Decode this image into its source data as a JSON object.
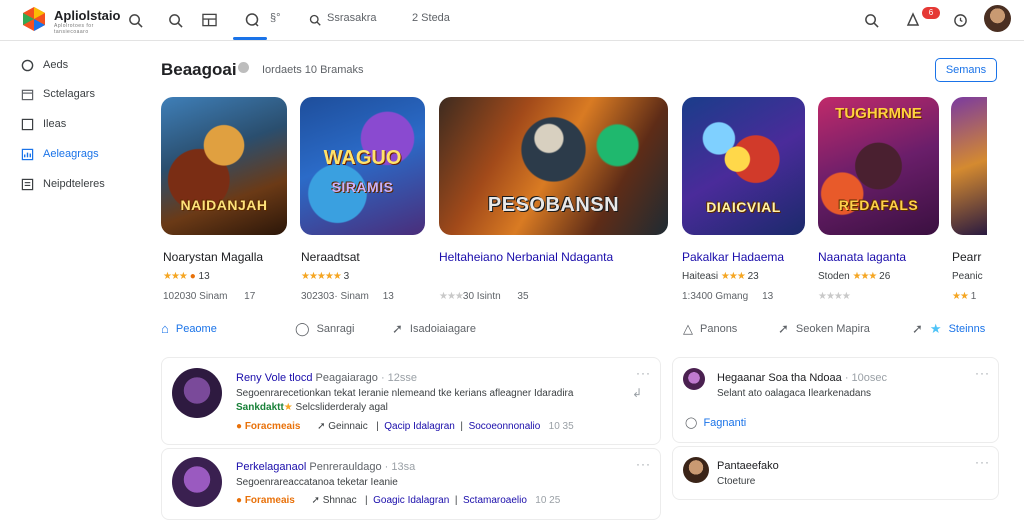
{
  "app": {
    "name": "Apliolstaio",
    "tagline": "Aplolrotoes for tansiecoaaro"
  },
  "topbar": {
    "tabs": [
      "§°",
      "Ssrasakra",
      "2 Steda"
    ],
    "notification_count": "6"
  },
  "sidebar": {
    "items": [
      {
        "label": "Aeds",
        "icon": "circle-icon"
      },
      {
        "label": "Sctelagars",
        "icon": "calendar-icon"
      },
      {
        "label": "Ileas",
        "icon": "square-icon"
      },
      {
        "label": "Aeleagrags",
        "icon": "chart-icon"
      },
      {
        "label": "Neipdteleres",
        "icon": "list-icon"
      }
    ],
    "active_index": 3
  },
  "section": {
    "title": "Beaagoai",
    "subtitle": "Iordaets 10 Bramaks",
    "see_all": "Semans"
  },
  "cards": [
    {
      "art_text": "NAIDANJAH",
      "art_top": "",
      "title": "Noarystan Magalla",
      "stars": "★★★",
      "meta": "13",
      "stats": "102030 Sinam",
      "stats2": "17"
    },
    {
      "art_text": "SIRAMIS",
      "art_top": "WAGUO",
      "title": "Neraadtsat",
      "stars": "★★★★★",
      "meta": "3",
      "stats": "302303· Sinam",
      "stats2": "13"
    },
    {
      "art_text": "PESOBANSN",
      "art_top": "",
      "title": "Heltaheiano Nerbanial Ndaganta",
      "stars": "★★★",
      "meta": "",
      "stats": "30 Isintn",
      "stats2": "35"
    },
    {
      "art_text": "DIAICVIAL",
      "art_top": "",
      "title": "Pakalkar Hadaema",
      "stars": "★★★",
      "meta_prefix": "Haiteasi",
      "meta": "23",
      "stats": "1:3400 Gmang",
      "stats2": "13"
    },
    {
      "art_text": "REDAFALS",
      "art_top": "TUGHRMNE",
      "title": "Naanata laganta",
      "stars": "★★★",
      "meta_prefix": "Stoden",
      "meta": "26",
      "stats": "",
      "stats2": ""
    },
    {
      "art_text": "",
      "art_top": "",
      "title": "Pearr",
      "stars": "",
      "meta_prefix": "Peanic",
      "meta": "",
      "stats": "1",
      "stats2": ""
    }
  ],
  "actions": [
    {
      "label": "Peaome",
      "icon": "home-icon",
      "active": true
    },
    {
      "label": "Sanragi",
      "icon": "comment-icon"
    },
    {
      "label": "Isadoiaiagare",
      "icon": "share-icon"
    },
    {
      "label": "Panons",
      "icon": "triangle-icon"
    },
    {
      "label": "Seoken Mapira",
      "icon": "forward-icon"
    },
    {
      "label": "Steinns",
      "icon": "star-icon"
    }
  ],
  "posts": [
    {
      "name": "Reny Vole tlocd",
      "tag": "Peagaiarago",
      "time": "· 12sse",
      "line1": "Segoenrarecetionkan tekat Ieranie nlemeand tke kerians afleagner Idaradira",
      "line2_green": "Sankdaktt",
      "line2": "Selcsliderderaly agal",
      "link": "Foracmeais",
      "a1": "Geinnaic",
      "a2": "Qacip Idalagran",
      "a3": "Socoeonnonalio",
      "count": "10 35"
    },
    {
      "name": "Perkelaganaol",
      "tag": "Penrerauldago",
      "time": "· 13sa",
      "line1": "Segoenrareaccatanoa teketar Ieanie",
      "link": "Forameais",
      "a1": "Shnnac",
      "a2": "Goagic Idalagran",
      "a3": "Sctamaroaelio",
      "count": "10 25"
    }
  ],
  "side_posts": [
    {
      "title": "Hegaanar Soa tha Ndoaa",
      "time": "· 10osec",
      "line": "Selant ato oalagaca Ilearkenadans",
      "link": "Fagnanti"
    },
    {
      "title": "Pantaeefako",
      "line": "Ctoeture"
    }
  ],
  "colors": {
    "accent": "#1a73e8",
    "star": "#f5a623",
    "link_orange": "#e8710a",
    "green": "#188038"
  }
}
